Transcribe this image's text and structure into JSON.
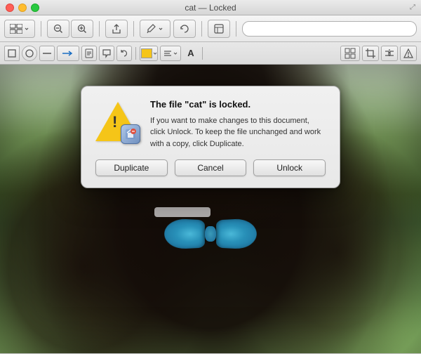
{
  "titlebar": {
    "title": "cat — Locked",
    "resize_icon": "⤢"
  },
  "toolbar1": {
    "view_btn": "⊞",
    "zoom_out_btn": "−",
    "zoom_in_btn": "+",
    "share_btn": "↗",
    "annotate_btn": "✏",
    "rotate_btn": "↺",
    "edit_btn": "✎",
    "search_placeholder": ""
  },
  "toolbar2": {
    "rect_btn": "□",
    "oval_btn": "○",
    "line_btn": "—",
    "arrow_btn": "→",
    "text_btn": "T",
    "speech_btn": "◯",
    "rotate2_btn": "↻",
    "color_label": "color",
    "align_label": "≡",
    "font_label": "A",
    "grid_btn": "⊞",
    "crop_btn": "⊡",
    "flip_btn": "⇔",
    "adjust_btn": "◈"
  },
  "modal": {
    "title": "The file \"cat\" is locked.",
    "body": "If you want to make changes to this document, click Unlock. To keep the file unchanged and work with a copy, click Duplicate.",
    "btn_duplicate": "Duplicate",
    "btn_cancel": "Cancel",
    "btn_unlock": "Unlock"
  }
}
